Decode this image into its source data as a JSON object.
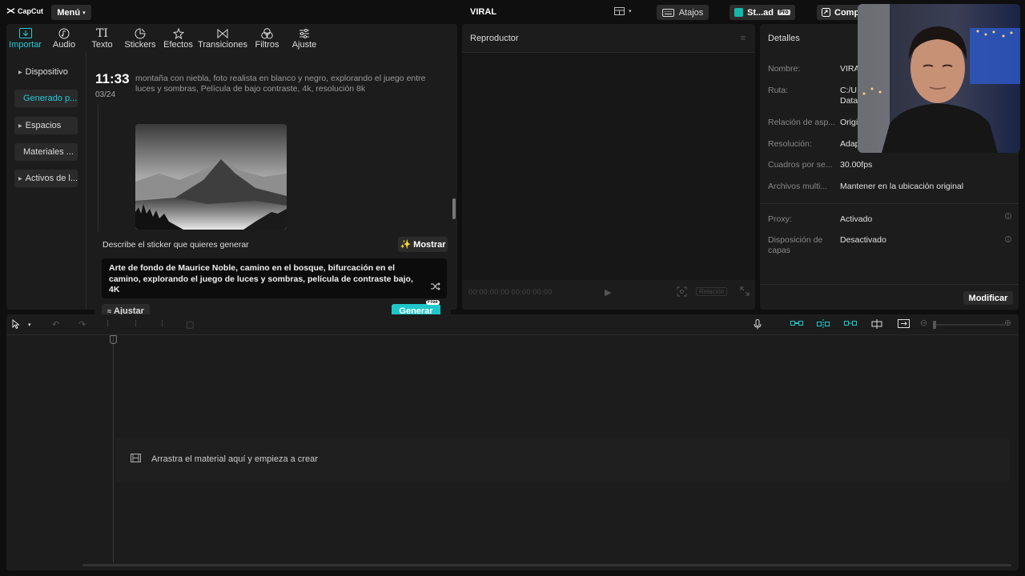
{
  "app": {
    "logo": "CapCut",
    "menu_label": "Menú",
    "project_title": "VIRAL",
    "atajos_label": "Atajos",
    "studio_label": "St...ad",
    "studio_badge": "Pro",
    "share_label": "Comparti"
  },
  "toolbar": {
    "tools": [
      {
        "label": "Importar",
        "icon": "import-icon",
        "active": true
      },
      {
        "label": "Audio",
        "icon": "audio-icon"
      },
      {
        "label": "Texto",
        "icon": "text-icon"
      },
      {
        "label": "Stickers",
        "icon": "sticker-icon"
      },
      {
        "label": "Efectos",
        "icon": "effects-icon"
      },
      {
        "label": "Transiciones",
        "icon": "transitions-icon"
      },
      {
        "label": "Filtros",
        "icon": "filters-icon"
      },
      {
        "label": "Ajuste",
        "icon": "adjust-icon"
      }
    ]
  },
  "sidebar": {
    "items": [
      {
        "label": "Dispositivo"
      },
      {
        "label": "Generado p...",
        "active": true
      },
      {
        "label": "Espacios"
      },
      {
        "label": "Materiales ..."
      },
      {
        "label": "Activos de l..."
      }
    ]
  },
  "history": {
    "time": "11:33",
    "date": "03/24",
    "prompt": "montaña con niebla, foto realista en blanco y negro, explorando el juego entre luces y sombras, Película de bajo contraste, 4k, resolución 8k"
  },
  "generator": {
    "label": "Describe el sticker que quieres generar",
    "mostrar_label": "Mostrar",
    "prompt_value": "Arte de fondo de Maurice Noble, camino en el bosque, bifurcación en el camino, explorando el juego de luces y sombras, película de contraste bajo, 4K",
    "ajustar_label": "Ajustar",
    "generar_label": "Generar",
    "free_badge": "Free"
  },
  "player": {
    "title": "Reproductor",
    "timecode": "00:00:00:00   00:00:00:00",
    "ratio_label": "Relación"
  },
  "details": {
    "title": "Detalles",
    "rows": [
      {
        "label": "Nombre:",
        "value": "VIRAL"
      },
      {
        "label": "Ruta:",
        "value": "C:/U...\nData..."
      },
      {
        "label": "Relación de asp...",
        "value": "Origi..."
      },
      {
        "label": "Resolución:",
        "value": "Adapta..."
      },
      {
        "label": "Cuadros por se...",
        "value": "30.00fps"
      },
      {
        "label": "Archivos multi...",
        "value": "Mantener en la ubicación original"
      },
      {
        "label": "Proxy:",
        "value": "Activado"
      },
      {
        "label": "Disposición de capas",
        "value": "Desactivado"
      }
    ],
    "modify_label": "Modificar"
  },
  "timeline": {
    "drop_text": "Arrastra el material aquí y empieza a crear"
  },
  "colors": {
    "accent": "#1ec7c9",
    "panel": "#1c1c1c",
    "background": "#0f0f0f"
  }
}
